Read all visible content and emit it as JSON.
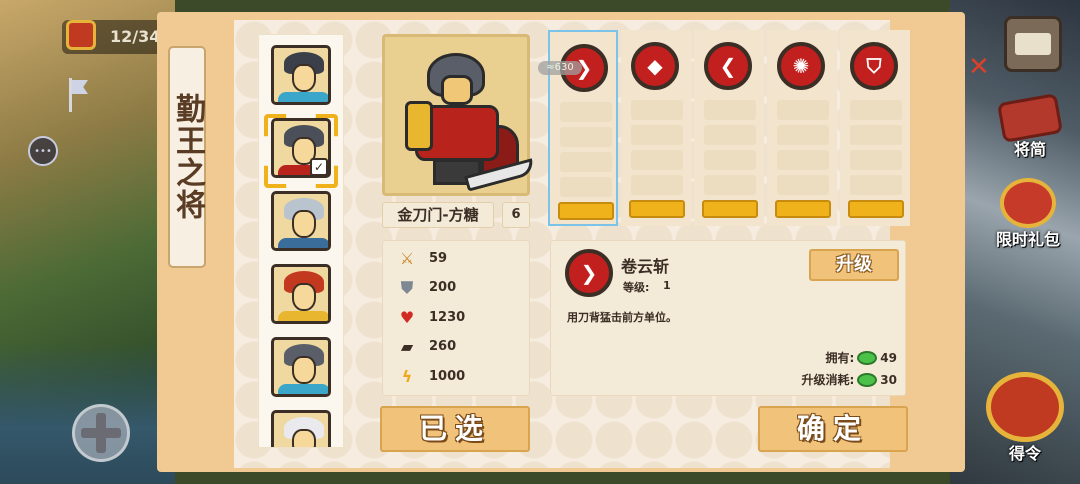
{
  "hud": {
    "progress_count": "12/34",
    "shop_icon": "shop-stall-icon",
    "book_label": "将简",
    "gift_label": "限时礼包",
    "order_label": "得令"
  },
  "panel": {
    "title": "勤王之将",
    "hero_list": [
      {
        "name": "hero-1",
        "hair": "#3a3f4a",
        "body": "#3aa6c9",
        "selected": false
      },
      {
        "name": "hero-2",
        "hair": "#4a4f5a",
        "body": "#b8231c",
        "selected": true
      },
      {
        "name": "hero-3",
        "hair": "#b9c4cf",
        "body": "#3b6d9a",
        "selected": false
      },
      {
        "name": "hero-4",
        "hair": "#c3391f",
        "body": "#e9b630",
        "selected": false
      },
      {
        "name": "hero-5",
        "hair": "#5a5e68",
        "body": "#3aa6c9",
        "selected": false
      },
      {
        "name": "hero-6",
        "hair": "#e9e9ee",
        "body": "#7d5a9a",
        "selected": false
      }
    ],
    "hero": {
      "name": "金刀门-方糖",
      "level": "6"
    },
    "stats": [
      {
        "icon": "sword-icon",
        "value": "59",
        "color": "#c98a2a"
      },
      {
        "icon": "shield-icon",
        "value": "200",
        "color": "#7e8894"
      },
      {
        "icon": "heart-icon",
        "value": "1230",
        "color": "#d02a22"
      },
      {
        "icon": "boot-icon",
        "value": "260",
        "color": "#3b2e25"
      },
      {
        "icon": "lightning-icon",
        "value": "1000",
        "color": "#f0a81b"
      }
    ],
    "exp_tag": "≈630",
    "skills": [
      {
        "icon": "slash-skill-icon",
        "glyph": "❯",
        "selected": true
      },
      {
        "icon": "wolf-skill-icon",
        "glyph": "◆",
        "selected": false
      },
      {
        "icon": "claw-skill-icon",
        "glyph": "❮",
        "selected": false
      },
      {
        "icon": "whirl-skill-icon",
        "glyph": "✺",
        "selected": false
      },
      {
        "icon": "guard-skill-icon",
        "glyph": "⛉",
        "selected": false
      }
    ],
    "detail": {
      "name": "卷云斩",
      "level_label": "等级:",
      "level": "1",
      "description": "用刀背猛击前方单位。",
      "upgrade_label": "升级",
      "owned_label": "拥有:",
      "owned": "49",
      "cost_label": "升级消耗:",
      "cost": "30"
    },
    "selected_button": "已选",
    "confirm_button": "确定"
  }
}
